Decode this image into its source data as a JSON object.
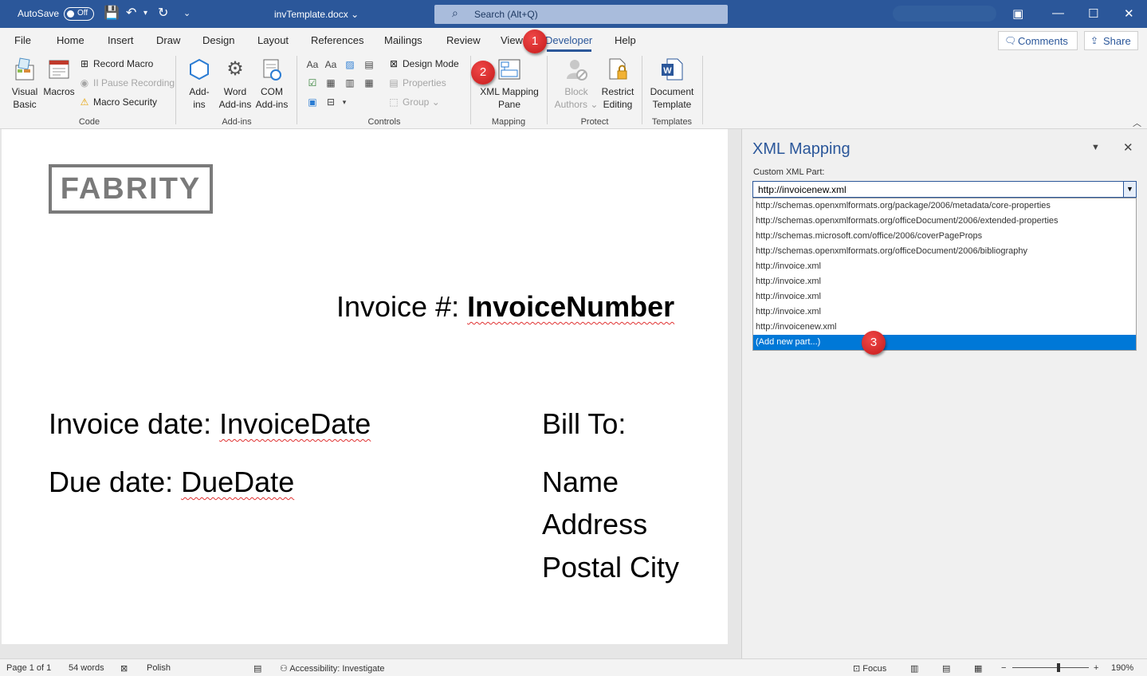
{
  "titlebar": {
    "autosave_label": "AutoSave",
    "autosave_state": "Off",
    "doc_name": "invTemplate.docx",
    "search_placeholder": "Search (Alt+Q)"
  },
  "tabs": [
    "File",
    "Home",
    "Insert",
    "Draw",
    "Design",
    "Layout",
    "References",
    "Mailings",
    "Review",
    "View",
    "Developer",
    "Help"
  ],
  "active_tab": "Developer",
  "header_buttons": {
    "comments": "Comments",
    "share": "Share"
  },
  "ribbon": {
    "code": {
      "label": "Code",
      "visual_basic": [
        "Visual",
        "Basic"
      ],
      "macros": "Macros",
      "record_macro": "Record Macro",
      "pause_recording": "II Pause Recording",
      "macro_security": "Macro Security"
    },
    "addins": {
      "label": "Add-ins",
      "addins": [
        "Add-",
        "ins"
      ],
      "word_addins": [
        "Word",
        "Add-ins"
      ],
      "com_addins": [
        "COM",
        "Add-ins"
      ]
    },
    "controls": {
      "label": "Controls",
      "design_mode": "Design Mode",
      "properties": "Properties",
      "group": "Group"
    },
    "mapping": {
      "label": "Mapping",
      "xml_mapping_pane": [
        "XML Mapping",
        "Pane"
      ]
    },
    "protect": {
      "label": "Protect",
      "block_authors": [
        "Block",
        "Authors"
      ],
      "restrict_editing": [
        "Restrict",
        "Editing"
      ]
    },
    "templates": {
      "label": "Templates",
      "document_template": [
        "Document",
        "Template"
      ]
    }
  },
  "document": {
    "logo": "FABRITY",
    "invoice_prefix": "Invoice #: ",
    "invoice_number": "InvoiceNumber",
    "invoice_date_prefix": "Invoice date: ",
    "invoice_date": "InvoiceDate",
    "due_date_prefix": "Due date: ",
    "due_date": "DueDate",
    "bill_to": "Bill To:",
    "name": "Name",
    "address": "Address",
    "postal_city": "Postal City"
  },
  "xml_pane": {
    "title": "XML Mapping",
    "custom_part_label": "Custom XML Part:",
    "selected_value": "http://invoicenew.xml",
    "options": [
      "http://schemas.openxmlformats.org/package/2006/metadata/core-properties",
      "http://schemas.openxmlformats.org/officeDocument/2006/extended-properties",
      "http://schemas.microsoft.com/office/2006/coverPageProps",
      "http://schemas.openxmlformats.org/officeDocument/2006/bibliography",
      "http://invoice.xml",
      "http://invoice.xml",
      "http://invoice.xml",
      "http://invoice.xml",
      "http://invoicenew.xml",
      "(Add new part...)"
    ],
    "highlighted_option": "(Add new part...)"
  },
  "callouts": [
    "1",
    "2",
    "3"
  ],
  "statusbar": {
    "page": "Page 1 of 1",
    "words": "54 words",
    "language": "Polish",
    "accessibility": "Accessibility: Investigate",
    "focus": "Focus",
    "zoom": "190%",
    "zoom_level": 1.9
  },
  "colors": {
    "word_blue": "#2b579a",
    "callout_red": "#d32020",
    "selection": "#0078d7",
    "spelling": "#e03131"
  }
}
